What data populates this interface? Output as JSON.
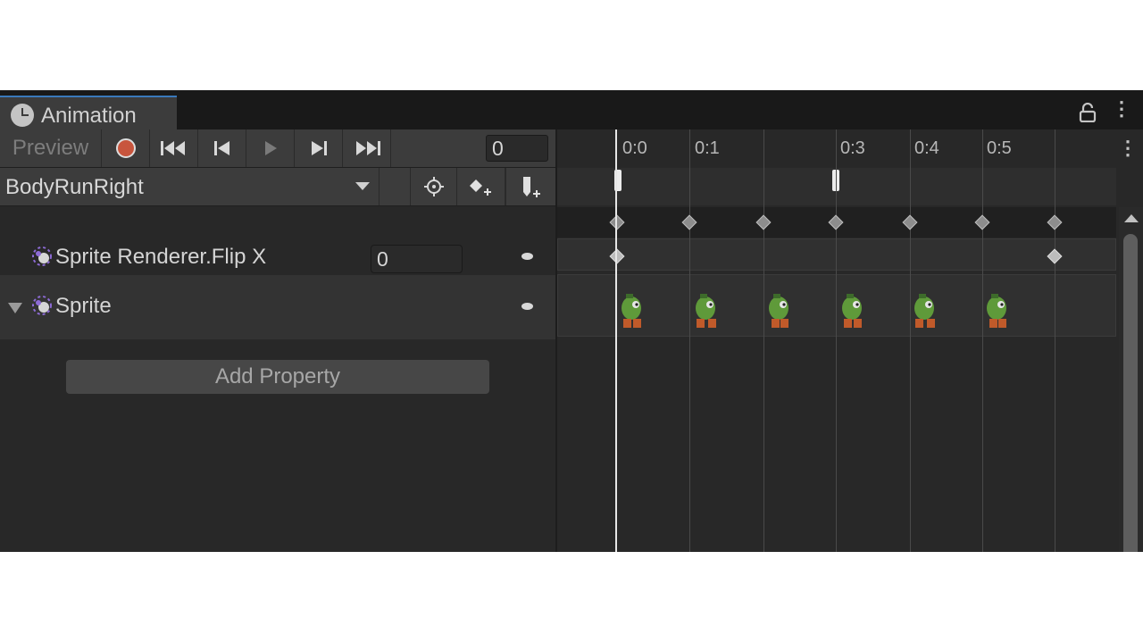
{
  "window": {
    "tab_title": "Animation"
  },
  "toolbar": {
    "preview_label": "Preview",
    "frame_value": "0"
  },
  "clip": {
    "selected_clip": "BodyRunRight"
  },
  "properties": [
    {
      "label": "Sprite Renderer.Flip X",
      "value": "0"
    },
    {
      "label": "Sprite"
    }
  ],
  "add_property_label": "Add Property",
  "timeline": {
    "ruler_labels": [
      "0:0",
      "0:1",
      "0:3",
      "0:4",
      "0:5"
    ]
  },
  "colors": {
    "accent_tab": "#3a79bb",
    "record": "#c8553d",
    "background": "#282828"
  }
}
